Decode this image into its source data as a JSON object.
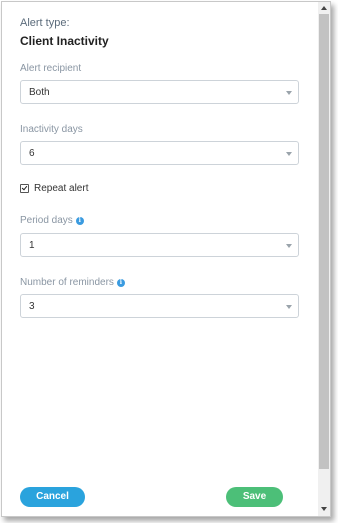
{
  "header": {
    "alert_type_label": "Alert type:",
    "alert_type_value": "Client Inactivity"
  },
  "fields": {
    "recipient": {
      "label": "Alert recipient",
      "value": "Both"
    },
    "inactivity_days": {
      "label": "Inactivity days",
      "value": "6"
    },
    "repeat_alert": {
      "label": "Repeat alert",
      "checked": true
    },
    "period_days": {
      "label": "Period days",
      "value": "1",
      "info_icon": "info-icon"
    },
    "reminders": {
      "label": "Number of reminders",
      "value": "3",
      "info_icon": "info-icon"
    }
  },
  "buttons": {
    "cancel": "Cancel",
    "save": "Save"
  },
  "colors": {
    "cancel": "#2aa3dd",
    "save": "#4cbf78",
    "info": "#3a9be0"
  }
}
